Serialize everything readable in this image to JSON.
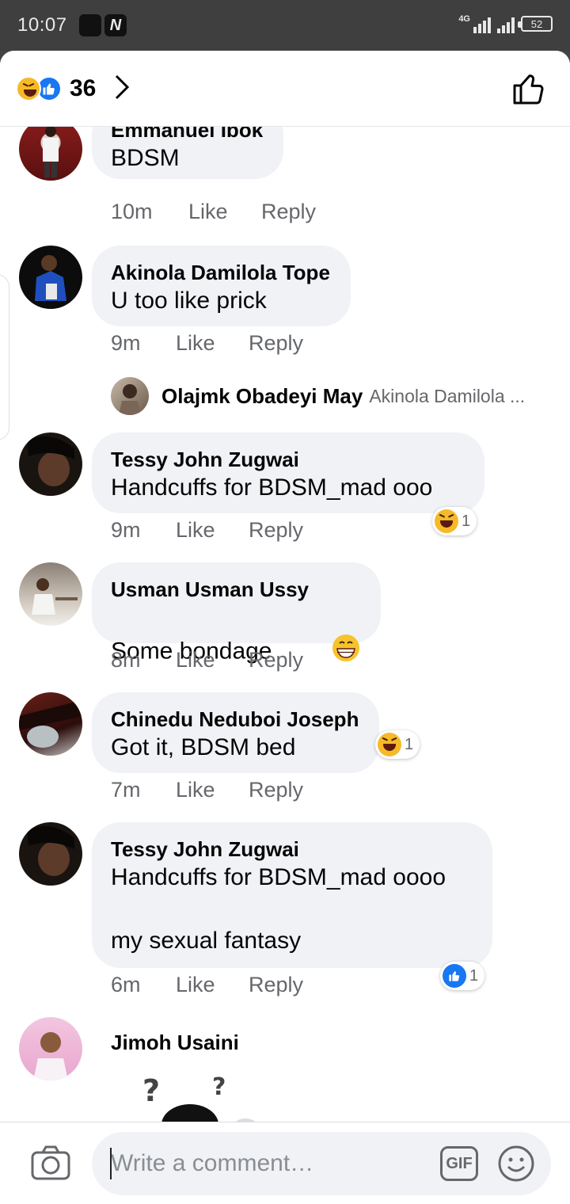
{
  "status_bar": {
    "time": "10:07",
    "app_icon": "N",
    "network": "4G",
    "battery": "52"
  },
  "header": {
    "reaction_count": "36",
    "reaction_types": [
      "haha",
      "like"
    ],
    "icons": [
      "chevron-right-icon",
      "thumbs-up-outline-icon"
    ]
  },
  "comments": [
    {
      "author": "Emmanuel Ibok",
      "text": "BDSM",
      "time": "10m",
      "like": "Like",
      "reply": "Reply"
    },
    {
      "author": "Akinola Damilola Tope",
      "text": "U too like prick",
      "time": "9m",
      "like": "Like",
      "reply": "Reply",
      "reply_preview": {
        "author": "Olajmk Obadeyi May",
        "text": "Akinola Damilola ..."
      }
    },
    {
      "author": "Tessy John Zugwai",
      "text": "Handcuffs for BDSM_mad ooo",
      "time": "9m",
      "like": "Like",
      "reply": "Reply",
      "reaction": {
        "type": "haha",
        "count": "1"
      }
    },
    {
      "author": "Usman Usman Ussy",
      "text": "Some bondage",
      "emoji": "grinning-face",
      "time": "8m",
      "like": "Like",
      "reply": "Reply"
    },
    {
      "author": "Chinedu Neduboi Joseph",
      "text": "Got it, BDSM bed",
      "time": "7m",
      "like": "Like",
      "reply": "Reply",
      "reaction": {
        "type": "haha",
        "count": "1"
      }
    },
    {
      "author": "Tessy John Zugwai",
      "text": "Handcuffs for BDSM_mad oooo\n\nmy sexual fantasy",
      "time": "6m",
      "like": "Like",
      "reply": "Reply",
      "reaction": {
        "type": "like",
        "count": "1"
      }
    },
    {
      "author": "Jimoh Usaini"
    }
  ],
  "composer": {
    "placeholder": "Write a comment…",
    "gif_label": "GIF",
    "icons": [
      "camera-icon",
      "emoji-icon"
    ]
  },
  "colors": {
    "status_bar": "#3f3f3f",
    "bubble": "#f0f2f5",
    "meta_text": "#65676b",
    "like_blue": "#1877f2",
    "haha_yellow": "#f7b928"
  }
}
